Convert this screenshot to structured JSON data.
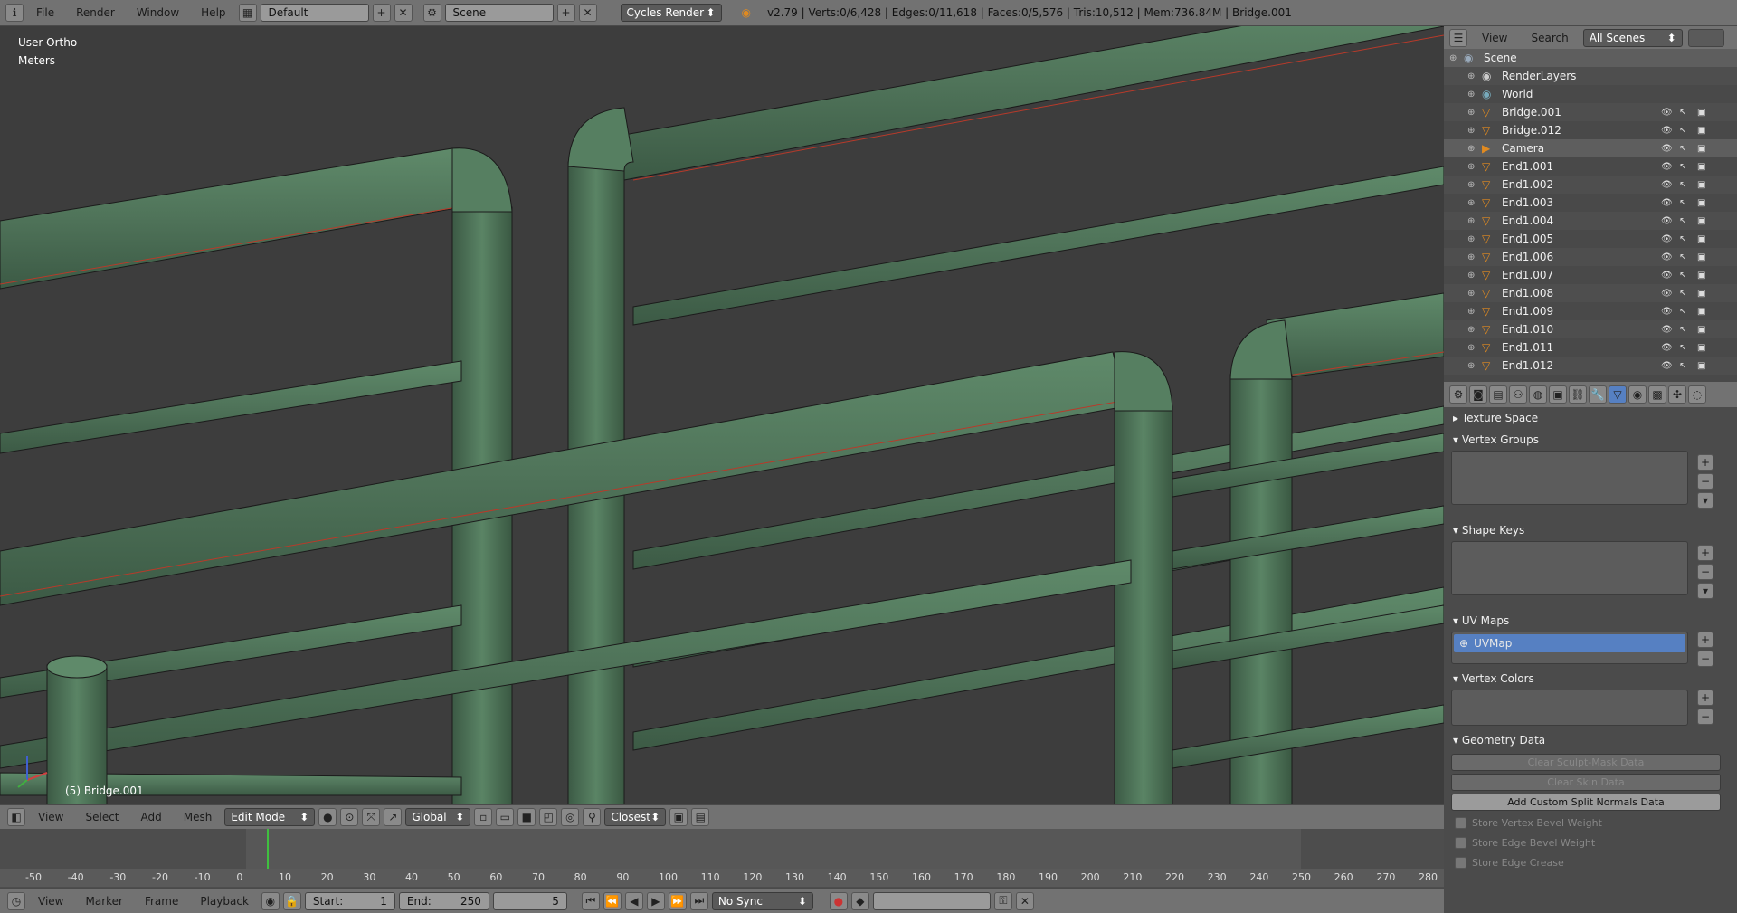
{
  "topbar": {
    "menus": [
      "File",
      "Render",
      "Window",
      "Help"
    ],
    "layout": "Default",
    "scene": "Scene",
    "engine": "Cycles Render",
    "stats": "v2.79 | Verts:0/6,428 | Edges:0/11,618 | Faces:0/5,576 | Tris:10,512 | Mem:736.84M | Bridge.001"
  },
  "viewport": {
    "view_label": "User Ortho",
    "unit_label": "Meters",
    "object_label": "(5) Bridge.001",
    "header": {
      "menus": [
        "View",
        "Select",
        "Add",
        "Mesh"
      ],
      "mode": "Edit Mode",
      "orientation": "Global",
      "snap": "Closest"
    }
  },
  "timeline": {
    "ticks": [
      "-50",
      "-40",
      "-30",
      "-20",
      "-10",
      "0",
      "10",
      "20",
      "30",
      "40",
      "50",
      "60",
      "70",
      "80",
      "90",
      "100",
      "110",
      "120",
      "130",
      "140",
      "150",
      "160",
      "170",
      "180",
      "190",
      "200",
      "210",
      "220",
      "230",
      "240",
      "250",
      "260",
      "270",
      "280"
    ],
    "menus": [
      "View",
      "Marker",
      "Frame",
      "Playback"
    ],
    "start_label": "Start:",
    "start": "1",
    "end_label": "End:",
    "end": "250",
    "current": "5",
    "sync": "No Sync",
    "current_frame": 5
  },
  "outliner": {
    "header": {
      "view": "View",
      "search": "Search",
      "filter": "All Scenes"
    },
    "items": [
      {
        "label": "Scene",
        "kind": "scene"
      },
      {
        "label": "RenderLayers",
        "kind": "renderlayers"
      },
      {
        "label": "World",
        "kind": "world"
      },
      {
        "label": "Bridge.001",
        "kind": "mesh"
      },
      {
        "label": "Bridge.012",
        "kind": "mesh"
      },
      {
        "label": "Camera",
        "kind": "camera"
      },
      {
        "label": "End1.001",
        "kind": "mesh"
      },
      {
        "label": "End1.002",
        "kind": "mesh"
      },
      {
        "label": "End1.003",
        "kind": "mesh"
      },
      {
        "label": "End1.004",
        "kind": "mesh"
      },
      {
        "label": "End1.005",
        "kind": "mesh"
      },
      {
        "label": "End1.006",
        "kind": "mesh"
      },
      {
        "label": "End1.007",
        "kind": "mesh"
      },
      {
        "label": "End1.008",
        "kind": "mesh"
      },
      {
        "label": "End1.009",
        "kind": "mesh"
      },
      {
        "label": "End1.010",
        "kind": "mesh"
      },
      {
        "label": "End1.011",
        "kind": "mesh"
      },
      {
        "label": "End1.012",
        "kind": "mesh"
      }
    ]
  },
  "properties": {
    "texture_space": "Texture Space",
    "vertex_groups": "Vertex Groups",
    "shape_keys": "Shape Keys",
    "uv_maps": "UV Maps",
    "uv_map_item": "UVMap",
    "vertex_colors": "Vertex Colors",
    "geometry_data": "Geometry Data",
    "buttons": {
      "clear_sculpt": "Clear Sculpt-Mask Data",
      "clear_skin": "Clear Skin Data",
      "add_split": "Add Custom Split Normals Data"
    },
    "checks": {
      "bevel_vert": "Store Vertex Bevel Weight",
      "bevel_edge": "Store Edge Bevel Weight",
      "crease": "Store Edge Crease"
    }
  },
  "colors": {
    "mesh": "#4f7359",
    "mesh_dark": "#3e5c47",
    "seam": "#b83a2a",
    "selection": "#5680c2",
    "frame_marker": "#3fbf3f"
  }
}
